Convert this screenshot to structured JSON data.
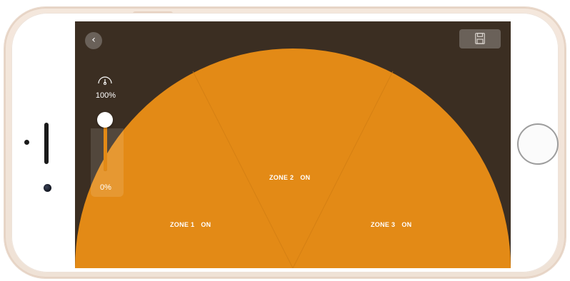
{
  "colors": {
    "screen_background": "#3b2e22",
    "zone_fill": "#e38a16",
    "zone_divider": "#cf7c12",
    "control_background": "#6a6159",
    "text": "#ffffff"
  },
  "header": {
    "back_icon": "chevron-left-icon",
    "save_icon": "floppy-disk-icon"
  },
  "slider": {
    "icon": "gauge-icon",
    "max_label": "100%",
    "min_label": "0%",
    "level_fraction": 1.0
  },
  "zones": [
    {
      "name": "ZONE 1",
      "state": "ON"
    },
    {
      "name": "ZONE 2",
      "state": "ON"
    },
    {
      "name": "ZONE 3",
      "state": "ON"
    }
  ]
}
